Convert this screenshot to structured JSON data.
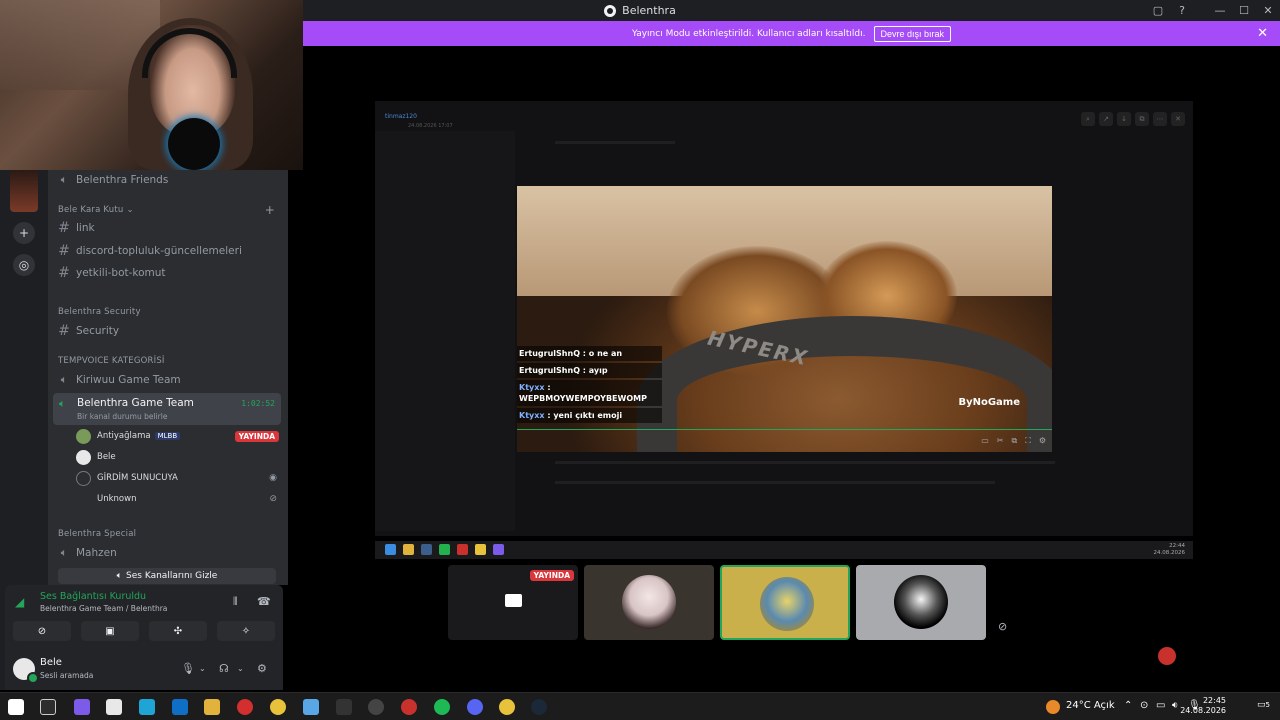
{
  "window": {
    "title": "Belenthra",
    "controls": [
      "▢",
      "?",
      "—",
      "☐",
      "✕"
    ]
  },
  "banner": {
    "message": "Yayıncı Modu etkinleştirildi. Kullanıcı adları kısaltıldı.",
    "button": "Devre dışı bırak",
    "close": "✕"
  },
  "channels": {
    "top_voice": "Belenthra Friends",
    "categories": [
      {
        "label": "Bele Kara Kutu",
        "chevron": "⌄",
        "plus": "+"
      },
      {
        "label": "Belenthra Security"
      },
      {
        "label": "TEMPVOICE KATEGORİSİ"
      },
      {
        "label": "Belenthra Special"
      }
    ],
    "text_channels": [
      "link",
      "discord-topluluk-güncellemeleri",
      "yetkili-bot-komut"
    ],
    "security_channel": "Security",
    "tempvoice_channel": "Kiriwuu Game Team",
    "active_channel": {
      "name": "Belenthra Game Team",
      "timer": "1:02:52",
      "status": "Bir kanal durumu belirle"
    },
    "members": [
      {
        "name": "Antiyağlama",
        "tag": "MLBB",
        "live": "YAYINDA"
      },
      {
        "name": "Bele"
      },
      {
        "name": "GİRDİM SUNUCUYA"
      },
      {
        "name": "Unknown"
      }
    ],
    "special_channel": "Mahzen",
    "hide_voice": "Ses Kanallarını Gizle"
  },
  "voice_panel": {
    "title": "Ses Bağlantısı Kuruldu",
    "subtitle": "Belenthra Game Team / Belenthra"
  },
  "user_panel": {
    "name": "Bele",
    "status": "Sesli aramada"
  },
  "shared_screen": {
    "header_name": "tinmaz120",
    "header_date": "24.08.2026 17:07"
  },
  "video": {
    "brand_logo": "HYPERX",
    "watermark": "ByNoGame",
    "chat": [
      {
        "user": "ErtugrulShnQ",
        "text": ": o ne an"
      },
      {
        "user": "ErtugrulShnQ",
        "text": ": ayıp"
      },
      {
        "user": "Ktyxx",
        "text": ": WEPBMOYWEMPOYBEWOMP"
      },
      {
        "user": "Ktyxx",
        "text": ": yeni çıktı emoji"
      }
    ]
  },
  "tiles": {
    "live": "YAYINDA"
  },
  "inner_taskbar": {
    "time": "22:44",
    "date": "24.08.2026"
  },
  "taskbar": {
    "weather": "24°C  Açık",
    "time": "22:45",
    "date": "24.08.2026",
    "notif_count": "5"
  },
  "colors": {
    "accent": "#a54cf8",
    "online": "#23a55a",
    "live": "#da373c",
    "bg": "#2b2d31"
  }
}
